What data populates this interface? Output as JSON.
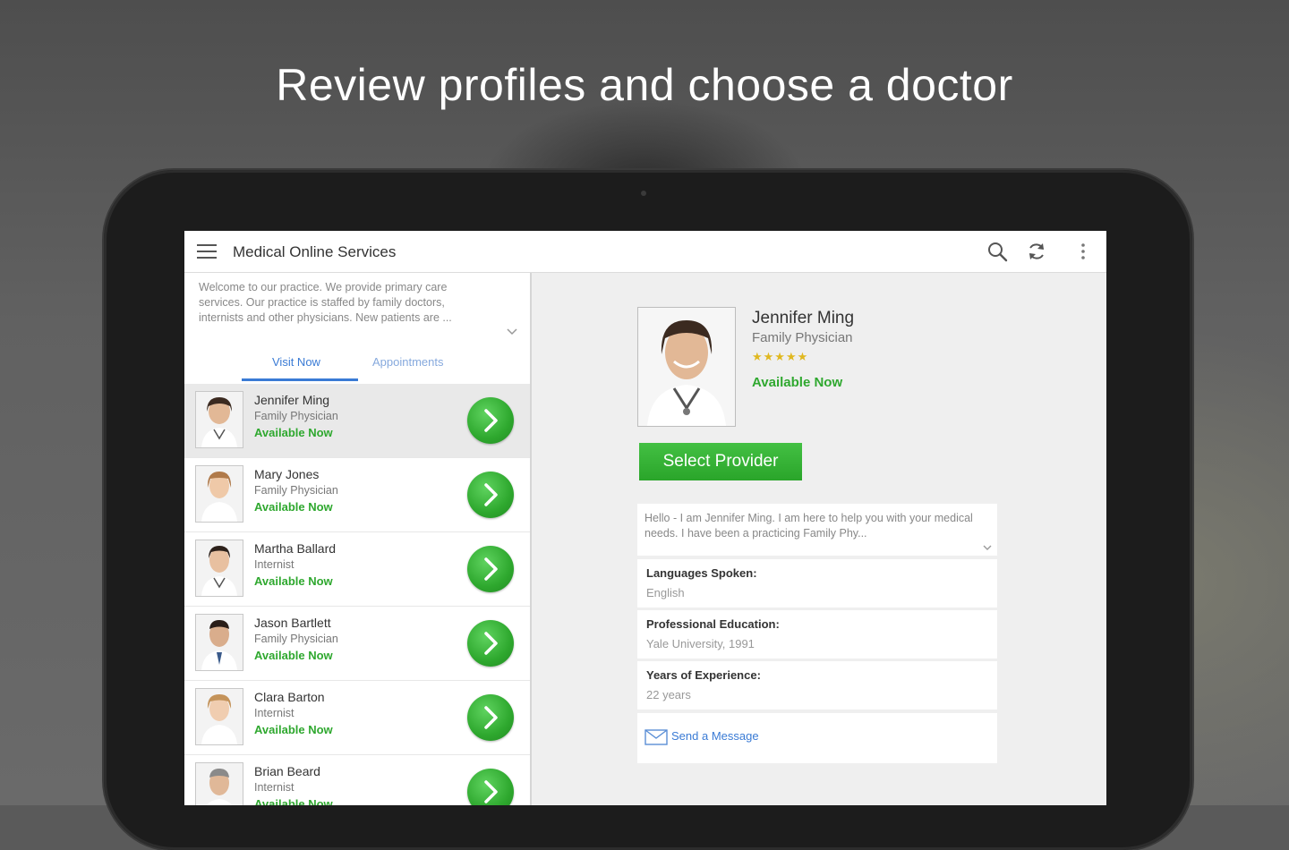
{
  "headline": "Review profiles and choose a doctor",
  "app": {
    "title": "Medical Online Services",
    "actions": [
      "search-icon",
      "refresh-icon",
      "overflow-menu-icon"
    ]
  },
  "welcome": "Welcome to our practice. We provide primary care services. Our practice is staffed by family doctors, internists and other physicians. New patients are ...",
  "tabs": [
    {
      "label": "Visit Now",
      "active": true
    },
    {
      "label": "Appointments",
      "active": false
    }
  ],
  "providers": [
    {
      "name": "Jennifer Ming",
      "specialty": "Family Physician",
      "status": "Available Now",
      "selected": true
    },
    {
      "name": "Mary Jones",
      "specialty": "Family Physician",
      "status": "Available Now",
      "selected": false
    },
    {
      "name": "Martha Ballard",
      "specialty": "Internist",
      "status": "Available Now",
      "selected": false
    },
    {
      "name": "Jason Bartlett",
      "specialty": "Family Physician",
      "status": "Available Now",
      "selected": false
    },
    {
      "name": "Clara Barton",
      "specialty": "Internist",
      "status": "Available Now",
      "selected": false
    },
    {
      "name": "Brian Beard",
      "specialty": "Internist",
      "status": "Available Now",
      "selected": false
    }
  ],
  "profile": {
    "name": "Jennifer Ming",
    "specialty": "Family Physician",
    "rating": 5,
    "stars": "★★★★★",
    "status": "Available Now",
    "select_label": "Select Provider",
    "bio": "Hello - I am Jennifer Ming. I am here to help you with your medical needs. I have been a practicing Family Phy...",
    "languages_label": "Languages Spoken:",
    "languages_value": "English",
    "education_label": "Professional Education:",
    "education_value": "Yale University, 1991",
    "experience_label": "Years of Experience:",
    "experience_value": "22 years",
    "message_label": "Send a Message"
  },
  "colors": {
    "accent_blue": "#3a7bd5",
    "available_green": "#2fa82f",
    "star_gold": "#e0b820"
  }
}
